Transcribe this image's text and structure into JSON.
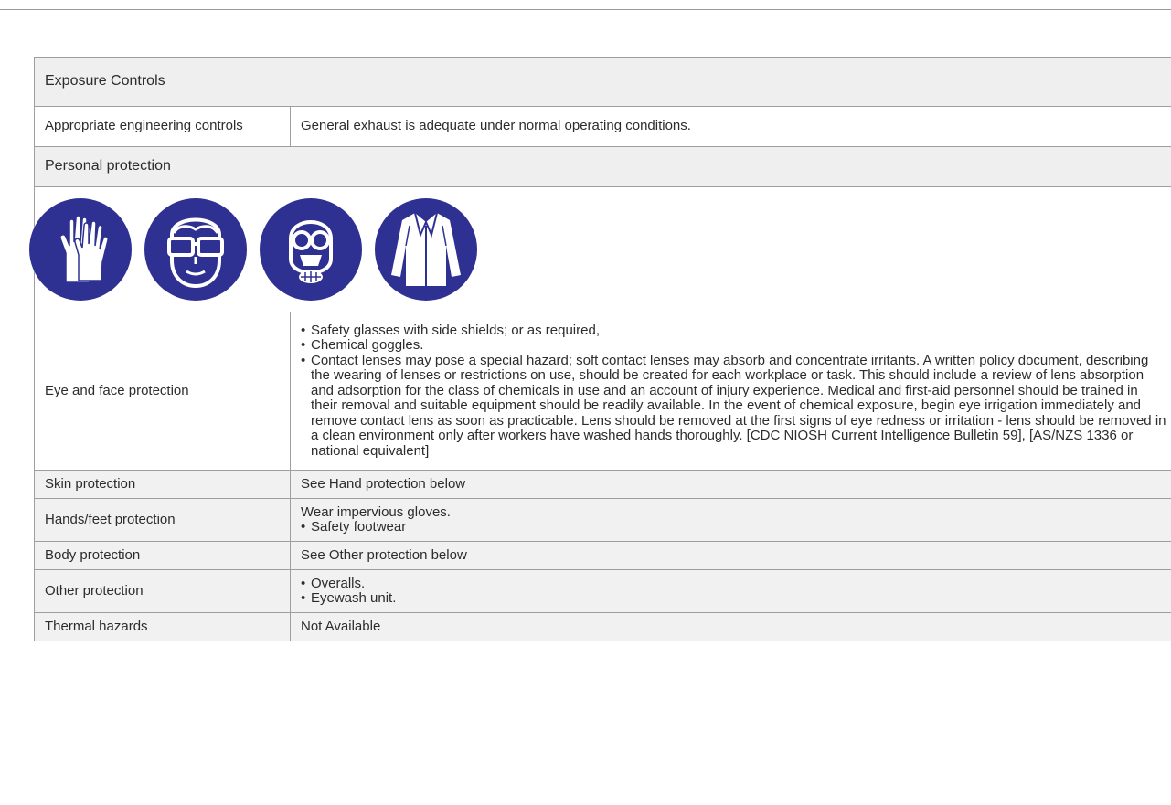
{
  "section_titles": {
    "exposure_controls": "Exposure Controls",
    "personal_protection": "Personal protection"
  },
  "engineering": {
    "label": "Appropriate engineering controls",
    "value": "General exhaust is adequate under normal operating conditions."
  },
  "ppe_icons": [
    "gloves-icon",
    "safety-glasses-icon",
    "respirator-icon",
    "lab-coat-icon"
  ],
  "eye_face": {
    "label": "Eye and face protection",
    "items": [
      "Safety glasses with side shields; or as required,",
      "Chemical goggles.",
      "Contact lenses may pose a special hazard; soft contact lenses may absorb and concentrate irritants. A written policy document, describing the wearing of lenses or restrictions on use, should be created for each workplace or task. This should include a review of lens absorption and adsorption for the class of chemicals in use and an account of injury experience. Medical and first-aid personnel should be trained in their removal and suitable equipment should be readily available. In the event of chemical exposure, begin eye irrigation immediately and remove contact lens as soon as practicable. Lens should be removed at the first signs of eye redness or irritation - lens should be removed in a clean environment only after workers have washed hands thoroughly. [CDC NIOSH Current Intelligence Bulletin 59], [AS/NZS 1336 or national equivalent]"
    ]
  },
  "skin": {
    "label": "Skin protection",
    "value": "See Hand protection below"
  },
  "hands_feet": {
    "label": "Hands/feet protection",
    "line1": "Wear impervious gloves.",
    "items": [
      "Safety footwear"
    ]
  },
  "body": {
    "label": "Body protection",
    "value": "See Other protection below"
  },
  "other": {
    "label": "Other protection",
    "items": [
      "Overalls.",
      "Eyewash unit."
    ]
  },
  "thermal": {
    "label": "Thermal hazards",
    "value": "Not Available"
  },
  "colors": {
    "icon_blue": "#2e3192",
    "header_bg": "#efefef",
    "band_bg": "#f1f1f1"
  }
}
